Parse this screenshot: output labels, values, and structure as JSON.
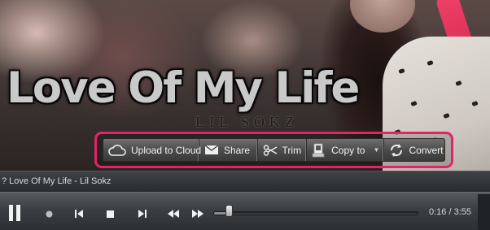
{
  "artwork": {
    "title_text": "Love Of My Life",
    "artist_text": "LIL SOKZ"
  },
  "toolbar": {
    "upload_label": "Upload to Cloud",
    "share_label": "Share",
    "trim_label": "Trim",
    "copy_label": "Copy to",
    "convert_label": "Convert",
    "highlight_color": "#e0246a"
  },
  "now_playing": {
    "text": "? Love Of My Life - Lil Sokz"
  },
  "playback": {
    "current_time": "0:16",
    "total_time": "3:55",
    "time_display": "0:16 / 3:55",
    "progress_fraction": 0.068
  },
  "icons": {
    "upload": "cloud-icon",
    "share": "envelope-icon",
    "trim": "scissors-icon",
    "copy": "copy-device-icon",
    "convert": "convert-arrows-icon",
    "pause": "pause-icon",
    "record": "record-icon",
    "previous": "previous-track-icon",
    "stop": "stop-icon",
    "next": "next-track-icon",
    "rewind": "rewind-icon",
    "fast_forward": "fast-forward-icon"
  }
}
